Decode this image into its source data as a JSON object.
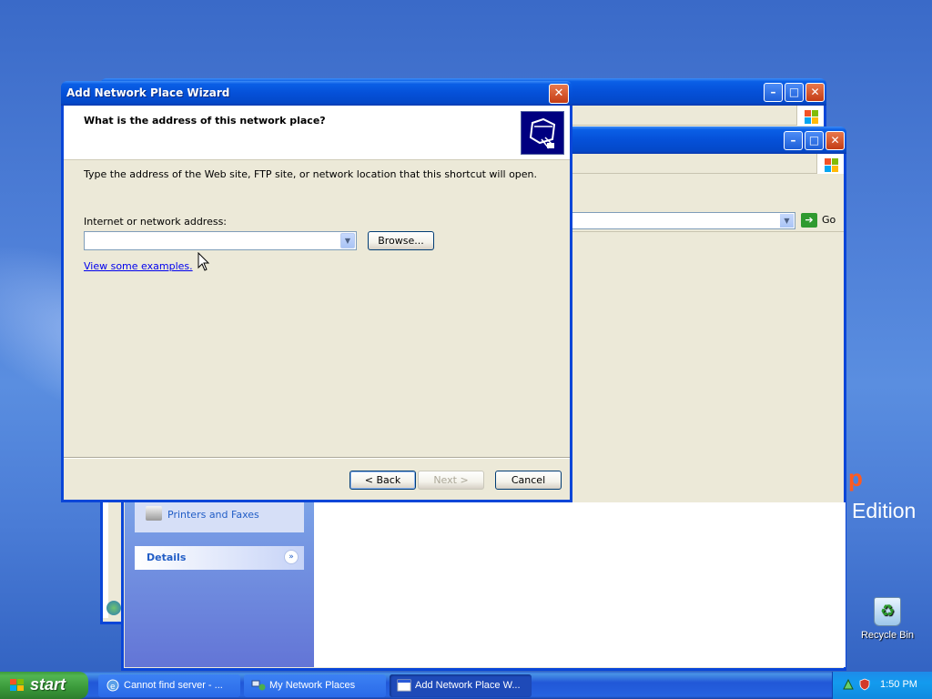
{
  "dialog": {
    "title": "Add Network Place Wizard",
    "close_glyph": "✕",
    "question": "What is the address of this network place?",
    "instruction": "Type the address of the Web site, FTP site, or network location that this shortcut will open.",
    "address_label": "Internet or network address:",
    "address_value": "",
    "browse_label": "Browse...",
    "examples_link": "View some examples.",
    "back_label": "< Back",
    "next_label": "Next >",
    "cancel_label": "Cancel"
  },
  "explorer": {
    "go_label": "Go",
    "task_item": "Printers and Faxes",
    "details_label": "Details",
    "details_glyph": "»"
  },
  "desktop": {
    "brand_text": "Edition",
    "brand_mark": "p",
    "recycle_bin_label": "Recycle Bin"
  },
  "taskbar": {
    "start_label": "start",
    "items": [
      {
        "label": "Cannot find server - ..."
      },
      {
        "label": "My Network Places"
      },
      {
        "label": "Add Network Place W..."
      }
    ],
    "clock": "1:50 PM"
  },
  "colors": {
    "titlebar_blue": "#0550d8",
    "start_green": "#3a993a",
    "link_blue": "#0000ee"
  }
}
